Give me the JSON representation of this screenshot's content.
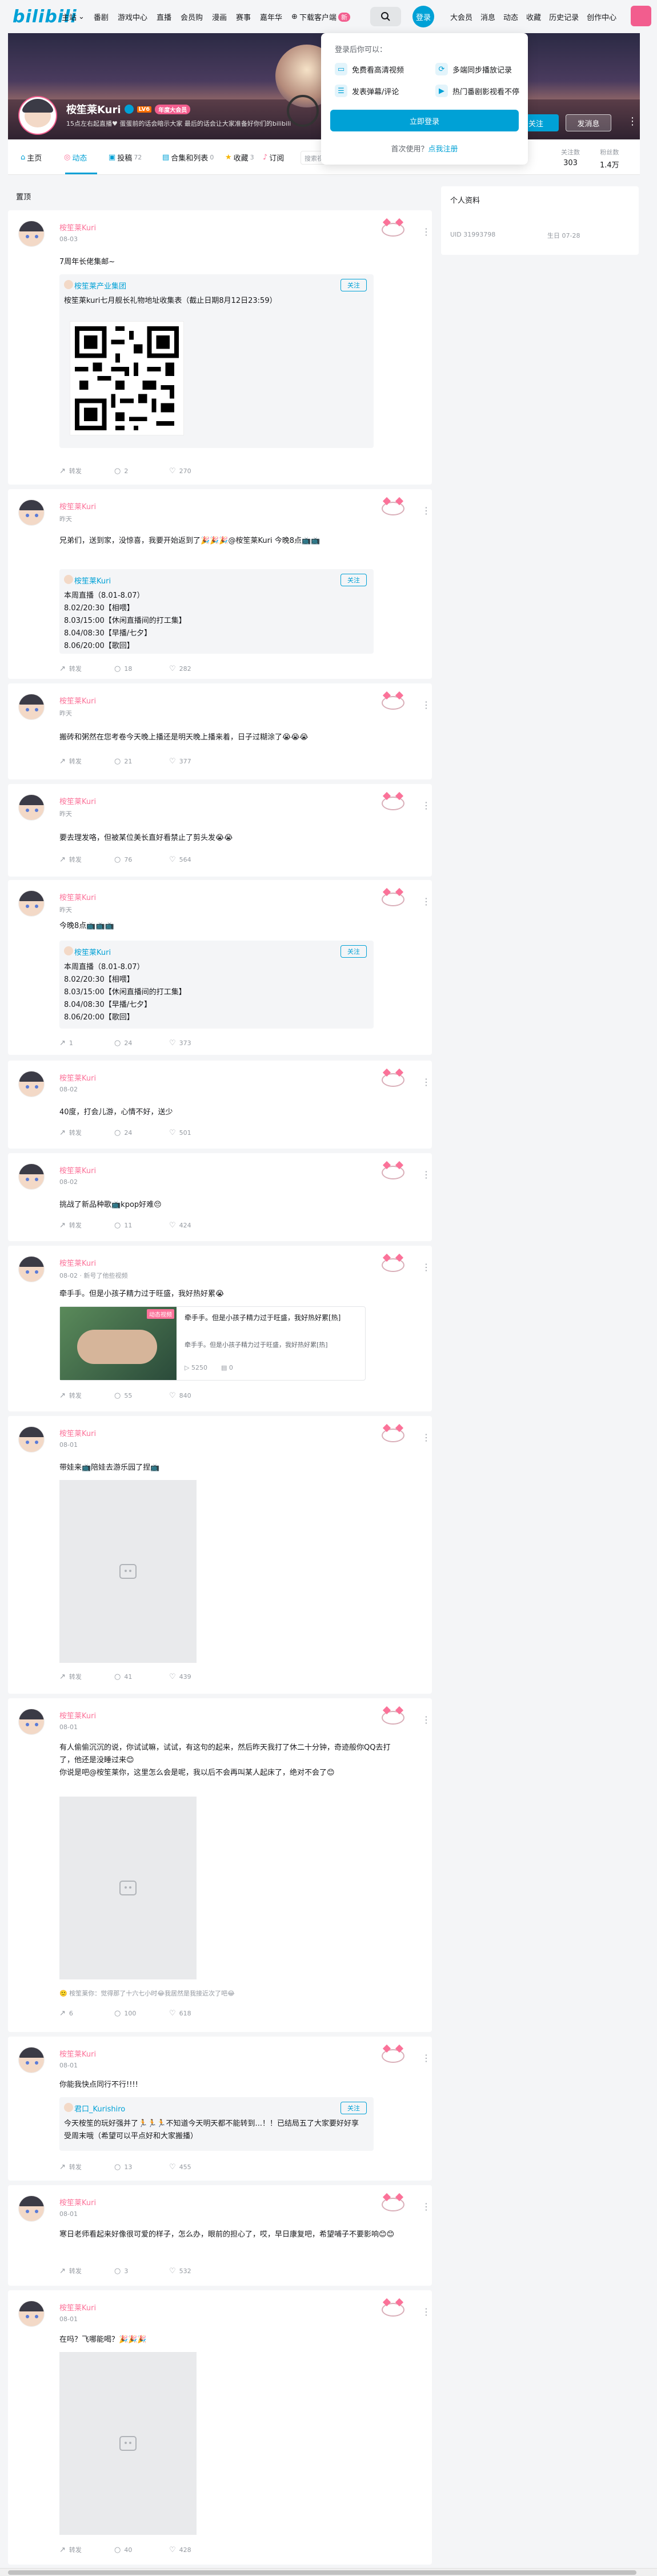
{
  "nav": {
    "logo": "bilibili",
    "links": [
      "主站",
      "番剧",
      "游戏中心",
      "直播",
      "会员购",
      "漫画",
      "赛事",
      "嘉年华",
      "下载客户端"
    ],
    "download_badge": "新",
    "login_label": "登录",
    "right_links": [
      "大会员",
      "消息",
      "动态",
      "收藏",
      "历史记录",
      "创作中心"
    ]
  },
  "login_popup": {
    "title": "登录后你可以：",
    "features": [
      "免费看高清视频",
      "多端同步播放记录",
      "发表弹幕/评论",
      "热门番剧影视看不停"
    ],
    "button": "立即登录",
    "register_prefix": "首次使用？",
    "register_link": "点我注册"
  },
  "profile": {
    "name": "桉笙莱Kuri",
    "level": "LV6",
    "vip": "年度大会员",
    "sign": "15点左右起直播♥ 蛋蛋前的话会暗示大家 最后的话会让大家准备好你们的bilibili",
    "follow_button": "关注",
    "message_button": "发消息",
    "more": "⋮",
    "stats": [
      {
        "label": "关注数",
        "value": "303"
      },
      {
        "label": "粉丝数",
        "value": "1.4万"
      }
    ]
  },
  "tabs": {
    "items": [
      {
        "label": "主页",
        "count": ""
      },
      {
        "label": "动态",
        "count": ""
      },
      {
        "label": "投稿",
        "count": "72"
      },
      {
        "label": "合集和列表",
        "count": "0"
      },
      {
        "label": "收藏",
        "count": "3"
      },
      {
        "label": "订阅",
        "count": ""
      }
    ],
    "search_placeholder": "搜索视频"
  },
  "section": {
    "label": "置顶"
  },
  "side": {
    "title": "个人资料",
    "uid": "UID 31993798",
    "birthday": "生日 07-28"
  },
  "posts": [
    {
      "name": "桉笙莱Kuri",
      "time": "08-03",
      "text": "7周年长佬集邮~",
      "repost": {
        "name": "桉笙莱产业集团",
        "follow": "关注",
        "text": "桉笙莱kuri七月舰长礼物地址收集表（截止日期8月12日23:59）"
      },
      "footer": [
        "转发",
        "2",
        "270"
      ]
    },
    {
      "name": "桉笙莱Kuri",
      "time": "昨天",
      "text": "兄弟们，送到家，没惊喜，我要开始返到了🎉🎉🎉@桉笙莱Kuri 今晚8点📺📺",
      "repost": {
        "name": "桉笙莱Kuri",
        "follow": "关注",
        "text": "本周直播（8.01-8.07）\n8.02/20:30【相喂】\n8.03/15:00【休闲直播间的打工集】\n8.04/08:30【早播/七夕】\n8.06/20:00【歌回】"
      },
      "footer": [
        "转发",
        "18",
        "282"
      ]
    },
    {
      "name": "桉笙莱Kuri",
      "time": "昨天",
      "text": "搬砖和粥然在您考卷今天晚上播还是明天晚上播来着，日子过糊涂了😭😭😭",
      "footer": [
        "转发",
        "21",
        "377"
      ]
    },
    {
      "name": "桉笙莱Kuri",
      "time": "昨天",
      "text": "要去理发咯，但被某位美长直好看禁止了剪头发😭😭",
      "footer": [
        "转发",
        "76",
        "564"
      ]
    },
    {
      "name": "桉笙莱Kuri",
      "time": "昨天",
      "text": "今晚8点📺📺📺",
      "repost": {
        "name": "桉笙莱Kuri",
        "follow": "关注",
        "text": "本周直播（8.01-8.07）\n8.02/20:30【相喂】\n8.03/15:00【休闲直播间的打工集】\n8.04/08:30【早播/七夕】\n8.06/20:00【歌回】"
      },
      "footer": [
        "1",
        "24",
        "373"
      ]
    },
    {
      "name": "桉笙莱Kuri",
      "time": "08-02",
      "text": "40度，打会儿游，心情不好，送少",
      "footer": [
        "转发",
        "24",
        "501"
      ]
    },
    {
      "name": "桉笙莱Kuri",
      "time": "08-02",
      "text": "挑战了新品种歌📺kpop好难😔",
      "footer": [
        "转发",
        "11",
        "424"
      ]
    },
    {
      "name": "桉笙莱Kuri",
      "time": "08-02 · 新号了他些视频",
      "text": "牵手手。但是小孩子精力过于旺盛，我好热好累😭",
      "video": {
        "badge": "动态视频",
        "title": "牵手手。但是小孩子精力过于旺盛，我好热好累[热]",
        "desc": "牵手手。但是小孩子精力过于旺盛，我好热好累[热]",
        "stats": [
          "5250",
          "0"
        ]
      },
      "footer": [
        "转发",
        "55",
        "840"
      ]
    },
    {
      "name": "桉笙莱Kuri",
      "time": "08-01",
      "text": "带娃来📺陪娃去游乐园了捏📺",
      "footer": [
        "转发",
        "41",
        "439"
      ]
    },
    {
      "name": "桉笙莱Kuri",
      "time": "08-01",
      "text": "有人偷偷沉沉的说，你试试嘛，试试，有这句的起来，然后昨天我打了休二十分钟，奇迹般你QQ去打了，他还是没睡过来😊\n你说是吧@桉笙莱你，这里怎么会是呢，我以后不会再叫某人起床了，绝对不会了😊",
      "comment": "🙂 桉笙莱你：觉得那了十六七小时😂我居然是我接近次了吧😂",
      "footer": [
        "6",
        "100",
        "618"
      ]
    },
    {
      "name": "桉笙莱Kuri",
      "time": "08-01",
      "text": "你能我快点同行不行!!!!",
      "repost": {
        "name": "君口_Kurishiro",
        "follow": "关注",
        "text": "今天桉笙的玩好强并了🏃🏃🏃不知道今天明天都不能转到...！！已结局五了大家要好好享受周末哦（希望可以平点好和大家搬播）"
      },
      "footer": [
        "转发",
        "13",
        "455"
      ]
    },
    {
      "name": "桉笙莱Kuri",
      "time": "08-01",
      "text": "寒日老师看起来好像很可爱的样子，怎么办，眼前的担心了，哎，早日康复吧，希望哺子不要影响😊😊",
      "footer": [
        "转发",
        "3",
        "532"
      ]
    },
    {
      "name": "桉笙莱Kuri",
      "time": "08-01",
      "text": "在吗？飞哪能喝？🎉🎉🎉",
      "footer": [
        "转发",
        "40",
        "428"
      ]
    }
  ]
}
